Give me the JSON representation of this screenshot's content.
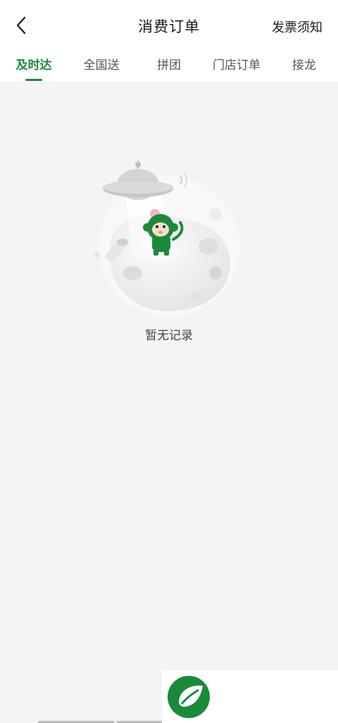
{
  "header": {
    "title": "消费订单",
    "right_link": "发票须知",
    "back_icon": "chevron-left-icon"
  },
  "tabs": [
    {
      "label": "及时达",
      "active": true
    },
    {
      "label": "全国送",
      "active": false
    },
    {
      "label": "拼团",
      "active": false
    },
    {
      "label": "门店订单",
      "active": false
    },
    {
      "label": "接龙",
      "active": false
    }
  ],
  "empty_state": {
    "text": "暂无记录",
    "illustration": "monkey-ufo-moon-illustration"
  },
  "colors": {
    "accent": "#1a8a3a",
    "background": "#f4f4f4",
    "header_bg": "#ffffff"
  },
  "logo": {
    "icon": "leaf-logo-icon"
  }
}
